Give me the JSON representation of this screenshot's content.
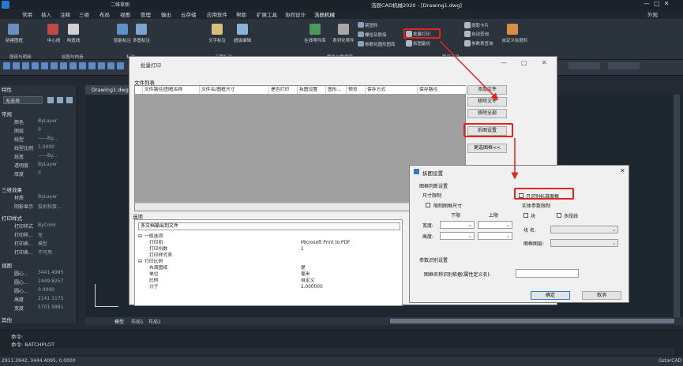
{
  "app": {
    "title": "浩辰CAD机械2020 - [Drawing1.dwg]",
    "quick_title": "二维草图",
    "right_label": "外观"
  },
  "menu": [
    "常用",
    "插入",
    "注释",
    "三维",
    "布局",
    "视图",
    "管理",
    "输出",
    "云存储",
    "应用软件",
    "帮助",
    "扩展工具",
    "协同设计",
    "浩辰机械"
  ],
  "ribbon": {
    "buttons": [
      "新建图框",
      "中心线",
      "构造线",
      "智能标注",
      "多图标注",
      "文字标注",
      "超级编辑",
      "在线零件库",
      "系列化零件",
      "螺栓及联接",
      "参数化圆形图库",
      "紧固件",
      "批量打印",
      "拆图备份",
      "提取卡片",
      "自动查询",
      "参数表查询",
      "自定义标题栏"
    ],
    "groups": [
      "图纸与明细",
      "绘图与构造",
      "标注",
      "工程标注",
      "零件与数据库",
      "图纸工具"
    ],
    "highlight_label": "批量打印"
  },
  "left_panel": {
    "title": "特性",
    "selector": "无选择",
    "sections": [
      {
        "name": "常规",
        "rows": [
          [
            "颜色",
            "ByLayer"
          ],
          [
            "图层",
            "0"
          ],
          [
            "线型",
            "——By..."
          ],
          [
            "线型比例",
            "1.0000"
          ],
          [
            "线宽",
            "——By..."
          ],
          [
            "透明度",
            "ByLayer"
          ],
          [
            "厚度",
            "0"
          ]
        ]
      },
      {
        "name": "三维效果",
        "rows": [
          [
            "材质",
            "ByLayer"
          ],
          [
            "阴影显示",
            "投射和接..."
          ]
        ]
      },
      {
        "name": "打印样式",
        "rows": [
          [
            "打印样式",
            "ByColor"
          ],
          [
            "打印样...",
            "无"
          ],
          [
            "打印表...",
            "模型"
          ],
          [
            "打印表...",
            "不可用"
          ]
        ]
      },
      {
        "name": "视图",
        "rows": [
          [
            "圆心...",
            "3441.4995"
          ],
          [
            "圆心...",
            "2449.8257"
          ],
          [
            "圆心...",
            "0.0000"
          ],
          [
            "高度",
            "2141.1175"
          ],
          [
            "宽度",
            "5701.5881"
          ]
        ]
      },
      {
        "name": "其他",
        "rows": []
      }
    ]
  },
  "doc_tab": "Drawing1.dwg",
  "batch_dialog": {
    "title": "批量打印",
    "file_list_label": "文件列表",
    "columns": [
      "文件路径/图框名称",
      "文件名/图框尺寸",
      "是否打印",
      "拆图设置",
      "图形...",
      "预览",
      "保存方式",
      "保存路径"
    ],
    "buttons": [
      "添加文件",
      "移除文件",
      "移除全部",
      "拆图设置",
      "更选图框<<"
    ],
    "options_label": "选项",
    "output_mode": "多文档输出到文件",
    "options": [
      {
        "key": "一般选项",
        "val": "",
        "group": true
      },
      {
        "key": "打印机",
        "val": "Microsoft Print to PDF",
        "group": false
      },
      {
        "key": "打印份数",
        "val": "1",
        "group": false
      },
      {
        "key": "打印样式表",
        "val": "",
        "group": false
      },
      {
        "key": "打印比例",
        "val": "",
        "group": true
      },
      {
        "key": "布满图纸",
        "val": "是",
        "group": false
      },
      {
        "key": "单位",
        "val": "毫米",
        "group": false
      },
      {
        "key": "比例",
        "val": "自定义",
        "group": false
      },
      {
        "key": "分子",
        "val": "1.000000",
        "group": false
      }
    ]
  },
  "split_dialog": {
    "title": "拆图设置",
    "frame_judge": "图框判断设置",
    "size_limit": "尺寸限制",
    "limit_size_cb": "限制图框尺寸",
    "lower": "下限",
    "upper": "上限",
    "width": "宽度:",
    "height": "高度:",
    "only_standard_cb": "只识别标准图框",
    "entity_params": "实体参数限制",
    "block_cb": "块",
    "polyline_cb": "多段线",
    "block_name": "块   名:",
    "frame_layer": "图框图层:",
    "param_recog": "参数识别设置",
    "frame_name_rule": "图框名称识别依据(属性定义名):",
    "ok": "确定",
    "cancel": "取消"
  },
  "command": {
    "line1": "命令:",
    "line2": "命令: BATCHPLOT"
  },
  "layout_tabs": [
    "模型",
    "布局1",
    "布局2"
  ],
  "status": {
    "coords": "2911.3942, 3444.4095, 0.0000",
    "brand": "GstarCAD"
  },
  "colors": {
    "highlight": "#e3241b",
    "dark_bg": "#232a33",
    "dialog_bg": "#f0f0f0"
  }
}
